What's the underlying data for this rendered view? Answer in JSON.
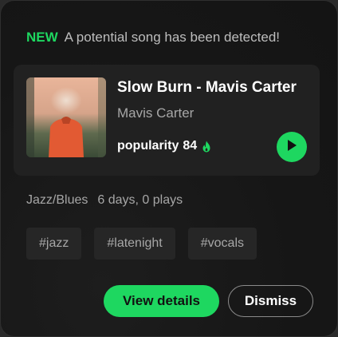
{
  "notice": {
    "badge": "NEW",
    "message": "A potential song has been detected!"
  },
  "song": {
    "title": "Slow Burn - Mavis Carter",
    "artist": "Mavis Carter",
    "popularity_label": "popularity",
    "popularity_value": "84",
    "popularity_icon": "flame-icon",
    "play_icon": "play-icon"
  },
  "meta": {
    "genre": "Jazz/Blues",
    "stats": "6 days, 0 plays"
  },
  "tags": [
    "#jazz",
    "#latenight",
    "#vocals"
  ],
  "actions": {
    "primary_label": "View details",
    "secondary_label": "Dismiss"
  },
  "colors": {
    "accent": "#1ed760",
    "background": "#161616",
    "surface": "#212121",
    "text_primary": "#ffffff",
    "text_secondary": "#a7a7a7"
  }
}
